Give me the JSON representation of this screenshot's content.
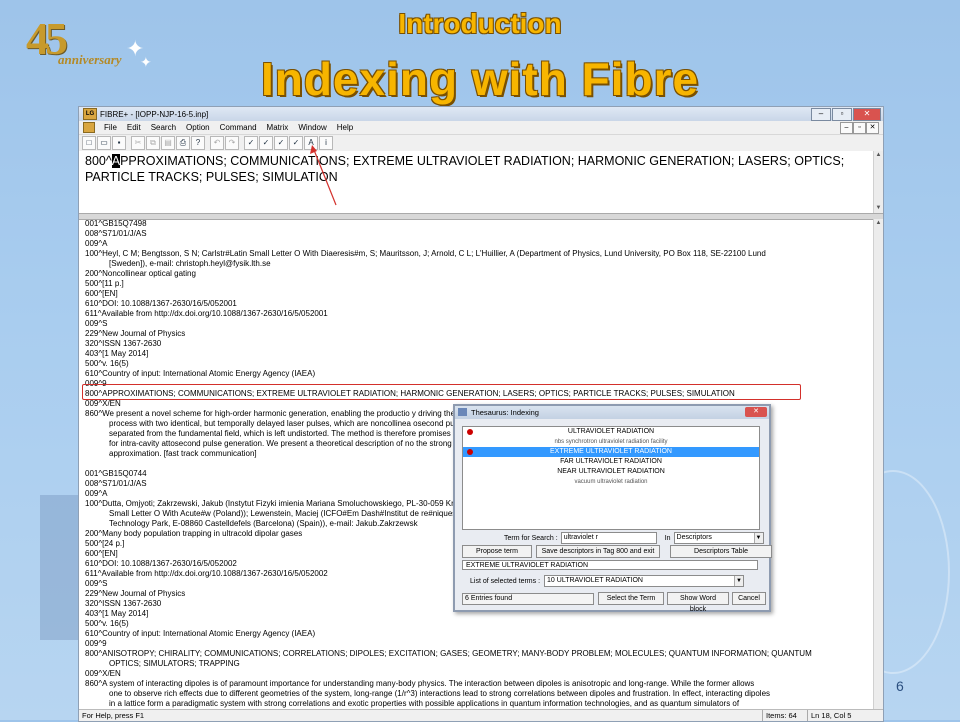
{
  "slide": {
    "logo_number": "45",
    "logo_text": "anniversary",
    "title_small": "Introduction",
    "title_large": "Indexing with Fibre",
    "page_number": "6"
  },
  "window": {
    "title": "FIBRE+ - [IOPP-NJP-16-5.inp]",
    "app_icon": "LG",
    "menu": [
      "File",
      "Edit",
      "Search",
      "Option",
      "Command",
      "Matrix",
      "Window",
      "Help"
    ],
    "toolbar_icons": [
      "new-icon",
      "open-icon",
      "save-icon",
      "cut-icon",
      "copy-icon",
      "paste-icon",
      "print-icon",
      "help-icon",
      "undo-icon",
      "redo-icon",
      "check-icon",
      "check-all-icon",
      "verify-icon",
      "verify-all-icon",
      "a-icon",
      "info-icon"
    ],
    "toolbar_glyphs": [
      "□",
      "▭",
      "▪",
      "✂",
      "⧉",
      "▤",
      "⎙",
      "?",
      "↶",
      "↷",
      "✓",
      "✓",
      "✓",
      "✓",
      "A",
      "i"
    ]
  },
  "editor": {
    "prefix": "800^",
    "cursor_char": "A",
    "rest": "PPROXIMATIONS; COMMUNICATIONS; EXTREME ULTRAVIOLET RADIATION; HARMONIC GENERATION; LASERS; OPTICS; PARTICLE TRACKS; PULSES; SIMULATION"
  },
  "records": [
    {
      "t": "001^GB15Q7498"
    },
    {
      "t": "008^S71/01/J/AS"
    },
    {
      "t": "009^A"
    },
    {
      "t": "100^Heyl, C M; Bengtsson, S N; Carlstr#Latin Small Letter O With Diaeresis#m, S; Mauritsson, J; Arnold, C L; L'Huillier, A (Department of Physics, Lund University, PO Box 118, SE-22100 Lund"
    },
    {
      "t": "[Sweden]), e-mail: christoph.heyl@fysik.lth.se",
      "indent": true
    },
    {
      "t": "200^Noncollinear optical gating"
    },
    {
      "t": "500^[11 p.]"
    },
    {
      "t": "600^[EN]"
    },
    {
      "t": "610^DOI: 10.1088/1367-2630/16/5/052001"
    },
    {
      "t": "611^Available from http://dx.doi.org/10.1088/1367-2630/16/5/052001"
    },
    {
      "t": "009^S"
    },
    {
      "t": "229^New Journal of Physics"
    },
    {
      "t": "320^ISSN 1367-2630"
    },
    {
      "t": "403^[1 May 2014]"
    },
    {
      "t": "500^v. 16(5)"
    },
    {
      "t": "610^Country of input: International Atomic Energy Agency (IAEA)"
    },
    {
      "t": "009^9"
    },
    {
      "t": "800^APPROXIMATIONS; COMMUNICATIONS; EXTREME ULTRAVIOLET RADIATION; HARMONIC GENERATION; LASERS; OPTICS; PARTICLE TRACKS; PULSES; SIMULATION"
    },
    {
      "t": "009^X/EN"
    },
    {
      "t": "860^We present a novel scheme for high-order harmonic generation, enabling the productio                                                      y driving the generation"
    },
    {
      "t": "process with two identical, but temporally delayed laser pulses, which are noncollinea                                                     osecond pulses directly",
      "indent": true
    },
    {
      "t": "separated from the fundamental field, which is left undistorted. The method is therefore                                                   promises new advances",
      "indent": true
    },
    {
      "t": "for intra-cavity attosecond pulse generation. We present a theoretical description of no                                                   the strong field",
      "indent": true
    },
    {
      "t": "approximation. [fast track communication]",
      "indent": true
    },
    {
      "t": "",
      "gap": true
    },
    {
      "t": "001^GB15Q0744"
    },
    {
      "t": "008^S71/01/J/AS"
    },
    {
      "t": "009^A"
    },
    {
      "t": "100^Dutta, Omjyoti; Zakrzewski, Jakub (Instytut Fizyki imienia Mariana Smoluchowskiego,                                                     PL-30-059 Krak#Latin"
    },
    {
      "t": "Small Letter O With Acute#w (Poland)); Lewenstein, Maciej (ICFO#Em Dash#Institut de                                                      re#niques, Mediterranean",
      "indent": true
    },
    {
      "t": "Technology Park, E-08860 Castelldefels (Barcelona) (Spain)), e-mail: Jakub.Zakrzewsk",
      "indent": true
    },
    {
      "t": "200^Many body population trapping in ultracold dipolar gases"
    },
    {
      "t": "500^[24 p.]"
    },
    {
      "t": "600^[EN]"
    },
    {
      "t": "610^DOI: 10.1088/1367-2630/16/5/052002"
    },
    {
      "t": "611^Available from http://dx.doi.org/10.1088/1367-2630/16/5/052002"
    },
    {
      "t": "009^S"
    },
    {
      "t": "229^New Journal of Physics"
    },
    {
      "t": "320^ISSN 1367-2630"
    },
    {
      "t": "403^[1 May 2014]"
    },
    {
      "t": "500^v. 16(5)"
    },
    {
      "t": "610^Country of input: International Atomic Energy Agency (IAEA)"
    },
    {
      "t": "009^9"
    },
    {
      "t": "800^ANISOTROPY; CHIRALITY; COMMUNICATIONS; CORRELATIONS; DIPOLES; EXCITATION; GASES; GEOMETRY; MANY-BODY PROBLEM; MOLECULES; QUANTUM INFORMATION; QUANTUM"
    },
    {
      "t": "OPTICS; SIMULATORS; TRAPPING",
      "indent": true
    },
    {
      "t": "009^X/EN"
    },
    {
      "t": "860^A system of interacting dipoles is of paramount importance for understanding many-body physics. The interaction between dipoles is anisotropic and long-range. While the former allows"
    },
    {
      "t": "one to observe rich effects due to different geometries of the system, long-range (1/r^3) interactions lead to strong correlations between dipoles and frustration. In effect, interacting dipoles",
      "indent": true
    },
    {
      "t": "in a lattice form a paradigmatic system with strong correlations and exotic properties with possible applications in quantum information technologies, and as quantum simulators of",
      "indent": true
    }
  ],
  "status": {
    "help": "For Help, press F1",
    "items": "Items: 64",
    "position": "Ln 18, Col 5"
  },
  "thesaurus": {
    "title": "Thesaurus:  Indexing",
    "terms": [
      {
        "label": "ULTRAVIOLET RADIATION",
        "small": false,
        "selected": false,
        "dot": true
      },
      {
        "label": "nbs synchrotron ultraviolet radiation facility",
        "small": true,
        "selected": false,
        "dot": false
      },
      {
        "label": "EXTREME ULTRAVIOLET RADIATION",
        "small": false,
        "selected": true,
        "dot": true
      },
      {
        "label": "FAR ULTRAVIOLET RADIATION",
        "small": false,
        "selected": false,
        "dot": false
      },
      {
        "label": "NEAR ULTRAVIOLET RADIATION",
        "small": false,
        "selected": false,
        "dot": false
      },
      {
        "label": "vacuum ultraviolet radiation",
        "small": true,
        "selected": false,
        "dot": false
      }
    ],
    "term_search_label": "Term for Search :",
    "term_search_value": "ultraviolet r",
    "in_label": "In",
    "in_value": "Descriptors",
    "propose_button": "Propose term",
    "save_button": "Save descriptors in Tag 800 and exit",
    "table_button": "Descriptors Table",
    "selected_field": "EXTREME ULTRAVIOLET RADIATION",
    "list_label": "List of selected terms :",
    "list_value": "10 ULTRAVIOLET RADIATION",
    "entries_found": "6 Entries found",
    "select_button": "Select the Term",
    "show_word_button": "Show Word block",
    "cancel_button": "Cancel"
  }
}
